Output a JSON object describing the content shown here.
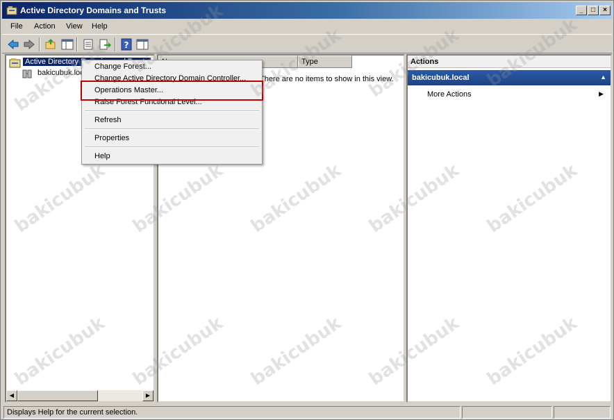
{
  "window": {
    "title": "Active Directory Domains and Trusts"
  },
  "menubar": {
    "items": [
      "File",
      "Action",
      "View",
      "Help"
    ]
  },
  "toolbar": {
    "buttons": [
      "back-icon",
      "forward-icon",
      "up-folder-icon",
      "show-hide-tree-icon",
      "properties-icon",
      "export-list-icon",
      "help-icon",
      "show-hide-action-pane-icon"
    ]
  },
  "tree": {
    "root": "Active Directory Domains and Trusts",
    "child": "bakicubuk.local"
  },
  "list": {
    "columns": [
      "Name",
      "Type"
    ],
    "empty_message": "There are no items to show in this view."
  },
  "actions": {
    "header": "Actions",
    "group": "bakicubuk.local",
    "items": [
      "More Actions"
    ]
  },
  "context_menu": {
    "items": [
      "Change Forest...",
      "Change Active Directory Domain Controller...",
      "Operations Master...",
      "Raise Forest Functional Level...",
      "Refresh",
      "Properties",
      "Help"
    ]
  },
  "statusbar": {
    "text": "Displays Help for the current selection."
  },
  "watermark": "bakicubuk",
  "colors": {
    "highlight": "#c00000",
    "selection": "#0a246a",
    "actions_group": "#1e4384"
  }
}
